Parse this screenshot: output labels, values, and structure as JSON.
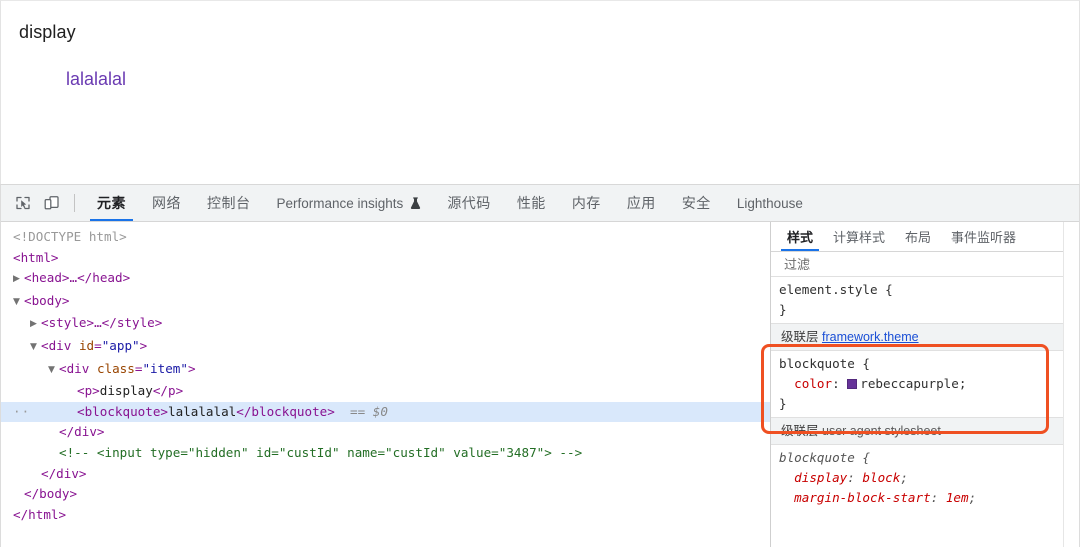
{
  "viewport": {
    "paragraph_text": "display",
    "blockquote_text": "lalalalal",
    "blockquote_color": "#6a3ab2"
  },
  "devtools": {
    "toolbar": {
      "inspect_icon": "inspect-element-icon",
      "device_icon": "device-toolbar-icon"
    },
    "tabs": [
      {
        "label": "元素",
        "active": true
      },
      {
        "label": "网络",
        "active": false
      },
      {
        "label": "控制台",
        "active": false
      },
      {
        "label": "Performance insights",
        "active": false,
        "badge": "flask-icon"
      },
      {
        "label": "源代码",
        "active": false
      },
      {
        "label": "性能",
        "active": false
      },
      {
        "label": "内存",
        "active": false
      },
      {
        "label": "应用",
        "active": false
      },
      {
        "label": "安全",
        "active": false
      },
      {
        "label": "Lighthouse",
        "active": false
      }
    ],
    "active_tab_underline_color": "#1a73e8"
  },
  "dom_tree": {
    "lines": {
      "doctype": "<!DOCTYPE html>",
      "html_open": "<html>",
      "head_collapsed": "<head>…</head>",
      "body_open": "<body>",
      "style_collapsed": "<style>…</style>",
      "div_app_tag": "div",
      "div_app_attr": "id",
      "div_app_value": "\"app\"",
      "div_item_tag": "div",
      "div_item_attr": "class",
      "div_item_value": "\"item\"",
      "p_open": "<p>",
      "p_text": "display",
      "p_close": "</p>",
      "blockquote_open": "<blockquote>",
      "blockquote_text": "lalalalal",
      "blockquote_close": "</blockquote>",
      "selected_marker": "== $0",
      "collapsed_dots": "··",
      "div_close_1": "</div>",
      "comment": "<!-- <input type=\"hidden\" id=\"custId\" name=\"custId\" value=\"3487\"> -->",
      "div_close_2": "</div>",
      "body_close": "</body>",
      "html_close": "</html>"
    },
    "selected_row_highlight": "#d9e8fb"
  },
  "styles_panel": {
    "tabs": [
      {
        "label": "样式",
        "active": true
      },
      {
        "label": "计算样式",
        "active": false
      },
      {
        "label": "布局",
        "active": false
      },
      {
        "label": "事件监听器",
        "active": false
      }
    ],
    "filter_placeholder": "过滤",
    "filter_value": "",
    "rules": [
      {
        "selector_line": "element.style {",
        "close_brace": "}",
        "declarations": []
      },
      {
        "origin_layer_label": "级联层",
        "origin_source": "framework.theme",
        "origin_is_link": true,
        "selector_line": "blockquote {",
        "close_brace": "}",
        "declarations": [
          {
            "property": "color",
            "value": "rebeccapurple",
            "swatch_color": "#663399"
          }
        ],
        "highlighted": true
      },
      {
        "origin_layer_label": "级联层",
        "origin_source": "user agent stylesheet",
        "origin_is_link": false,
        "selector_line": "blockquote {",
        "declarations": [
          {
            "property": "display",
            "value": "block"
          },
          {
            "property": "margin-block-start",
            "value": "1em"
          }
        ]
      }
    ]
  },
  "annotation": {
    "shape": "rounded-rectangle",
    "color": "#ef5022",
    "target": "blockquote-framework-theme-rule"
  }
}
